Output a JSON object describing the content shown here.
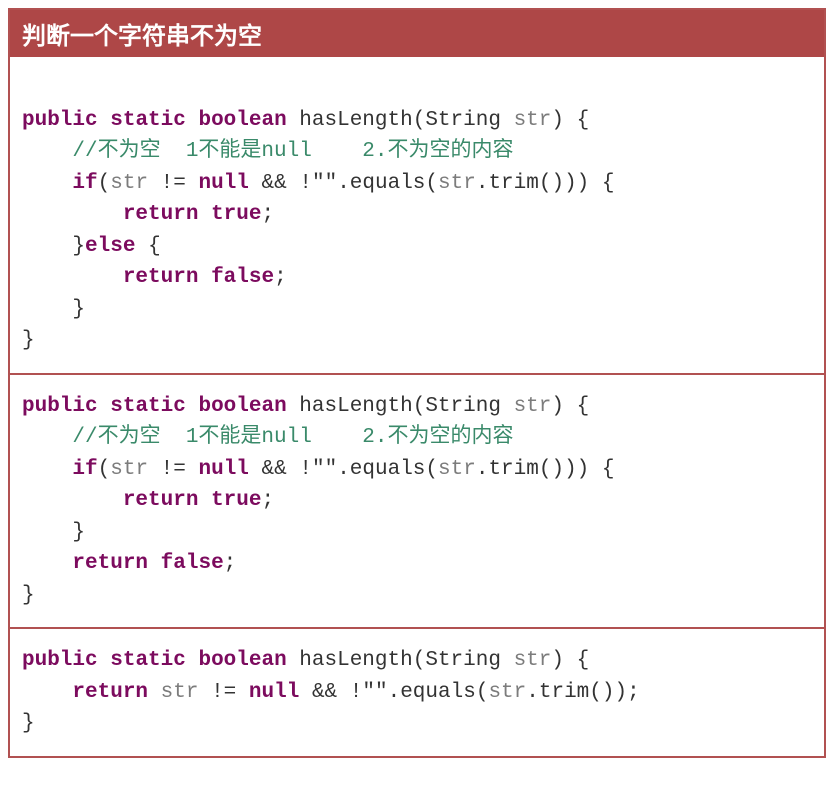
{
  "header": {
    "title": "判断一个字符串不为空"
  },
  "code": {
    "block1": {
      "kw_public": "public",
      "kw_static": "static",
      "kw_boolean": "boolean",
      "method_name": "hasLength",
      "type_string": "String",
      "var_str": "str",
      "comment": "//不为空  1不能是null    2.不为空的内容",
      "kw_if": "if",
      "kw_null": "null",
      "str_empty": "\"\"",
      "method_equals": "equals",
      "method_trim": "trim",
      "kw_return1": "return",
      "kw_true": "true",
      "kw_else": "else",
      "kw_return2": "return",
      "kw_false": "false"
    },
    "block2": {
      "kw_public": "public",
      "kw_static": "static",
      "kw_boolean": "boolean",
      "method_name": "hasLength",
      "type_string": "String",
      "var_str": "str",
      "comment": "//不为空  1不能是null    2.不为空的内容",
      "kw_if": "if",
      "kw_null": "null",
      "str_empty": "\"\"",
      "method_equals": "equals",
      "method_trim": "trim",
      "kw_return1": "return",
      "kw_true": "true",
      "kw_return2": "return",
      "kw_false": "false"
    },
    "block3": {
      "kw_public": "public",
      "kw_static": "static",
      "kw_boolean": "boolean",
      "method_name": "hasLength",
      "type_string": "String",
      "var_str": "str",
      "kw_return": "return",
      "kw_null": "null",
      "str_empty": "\"\"",
      "method_equals": "equals",
      "method_trim": "trim"
    }
  }
}
